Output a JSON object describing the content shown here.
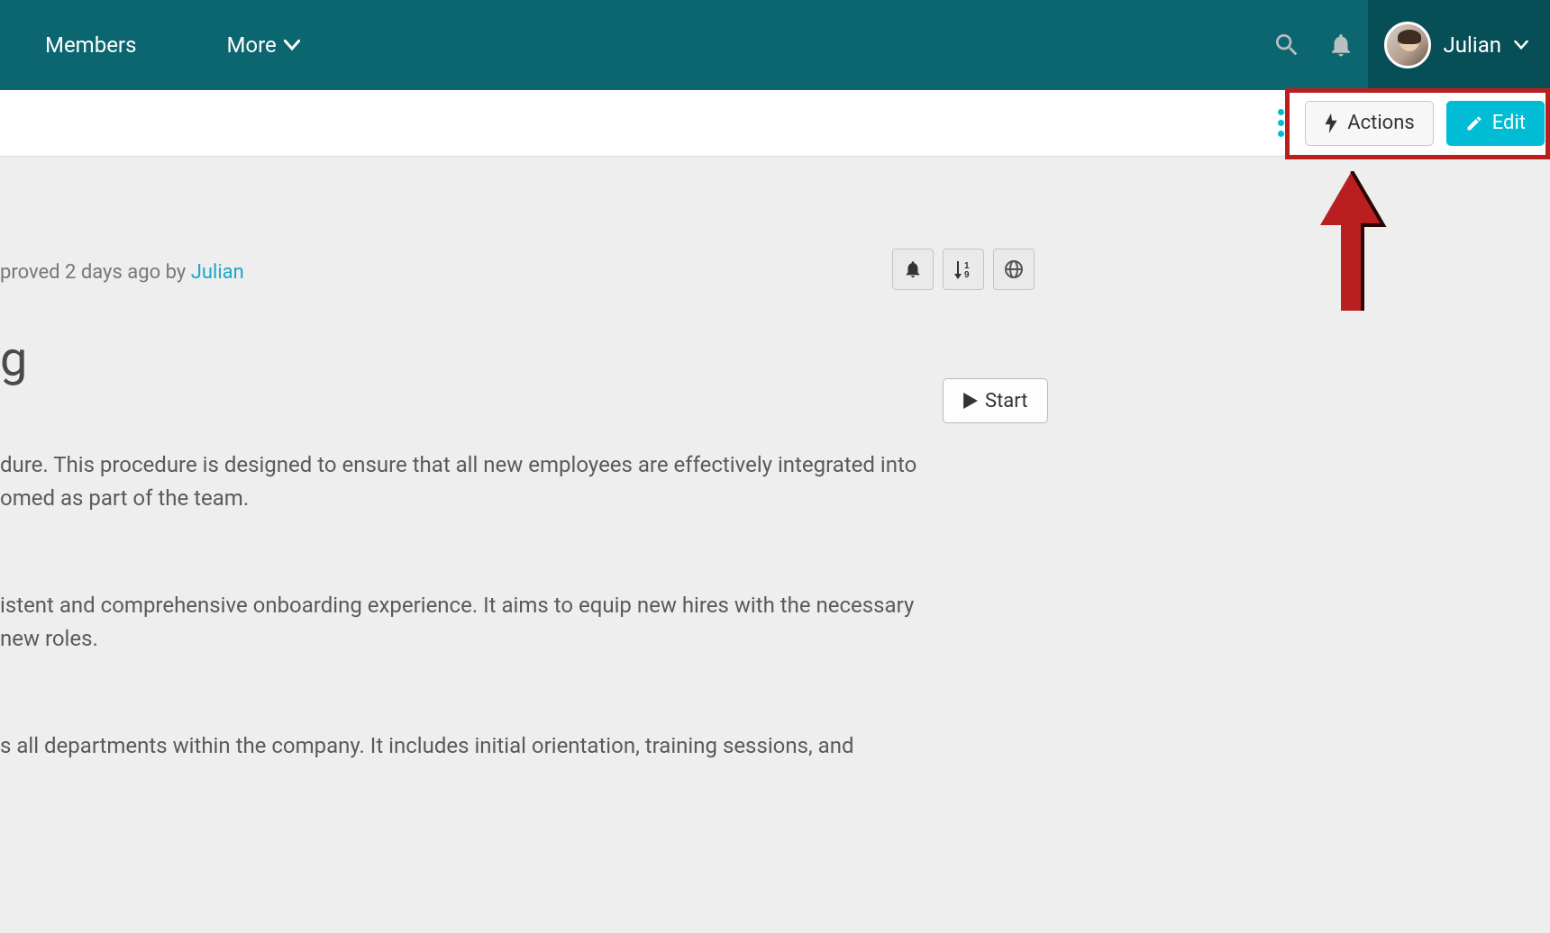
{
  "topbar": {
    "nav": {
      "members": "Members",
      "more": "More"
    },
    "user": {
      "name": "Julian"
    }
  },
  "actionbar": {
    "actions_label": "Actions",
    "edit_label": "Edit"
  },
  "page": {
    "meta_prefix": "proved 2 days ago by ",
    "meta_user": "Julian",
    "title_fragment": "g",
    "start_label": "Start",
    "paragraph1": "dure. This procedure is designed to ensure that all new employees are effectively integrated into omed as part of the team.",
    "paragraph2": "istent and comprehensive onboarding experience. It aims to equip new hires with the necessary new roles.",
    "paragraph3": "s all departments within the company. It includes initial orientation, training sessions, and"
  }
}
